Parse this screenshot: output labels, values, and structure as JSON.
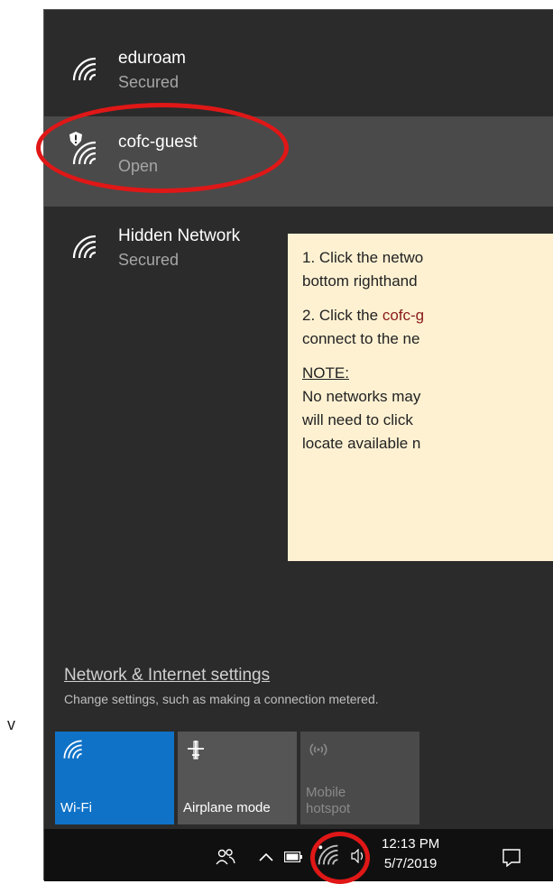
{
  "stray_text": "v",
  "networks": [
    {
      "name": "eduroam",
      "status": "Secured",
      "shield": false,
      "selected": false
    },
    {
      "name": "cofc-guest",
      "status": "Open",
      "shield": true,
      "selected": true
    },
    {
      "name": "Hidden Network",
      "status": "Secured",
      "shield": false,
      "selected": false
    }
  ],
  "callout": {
    "step1": "1. Click the netwo",
    "step1b": "bottom righthand",
    "step2_pre": "2. Click the ",
    "step2_hl": "cofc-g",
    "step2b": "connect to the ne",
    "note_heading": "NOTE:",
    "note_l1": "No networks may",
    "note_l2": "will need to click",
    "note_l3": "locate available n"
  },
  "settings": {
    "link": "Network & Internet settings",
    "desc": "Change settings, such as making a connection metered."
  },
  "tiles": {
    "wifi": "Wi-Fi",
    "airplane": "Airplane mode",
    "hotspot_l1": "Mobile",
    "hotspot_l2": "hotspot"
  },
  "taskbar": {
    "time": "12:13 PM",
    "date": "5/7/2019"
  },
  "colors": {
    "panel": "#2b2b2b",
    "selected_row": "#4a4a4a",
    "accent_tile": "#0f72c7",
    "annotation_red": "#e01717",
    "callout_bg": "#fdf1d2"
  },
  "icons": [
    "wifi-icon",
    "shield-icon",
    "airplane-icon",
    "hotspot-icon",
    "people-icon",
    "chevron-up-icon",
    "battery-icon",
    "volume-icon",
    "action-center-icon"
  ]
}
